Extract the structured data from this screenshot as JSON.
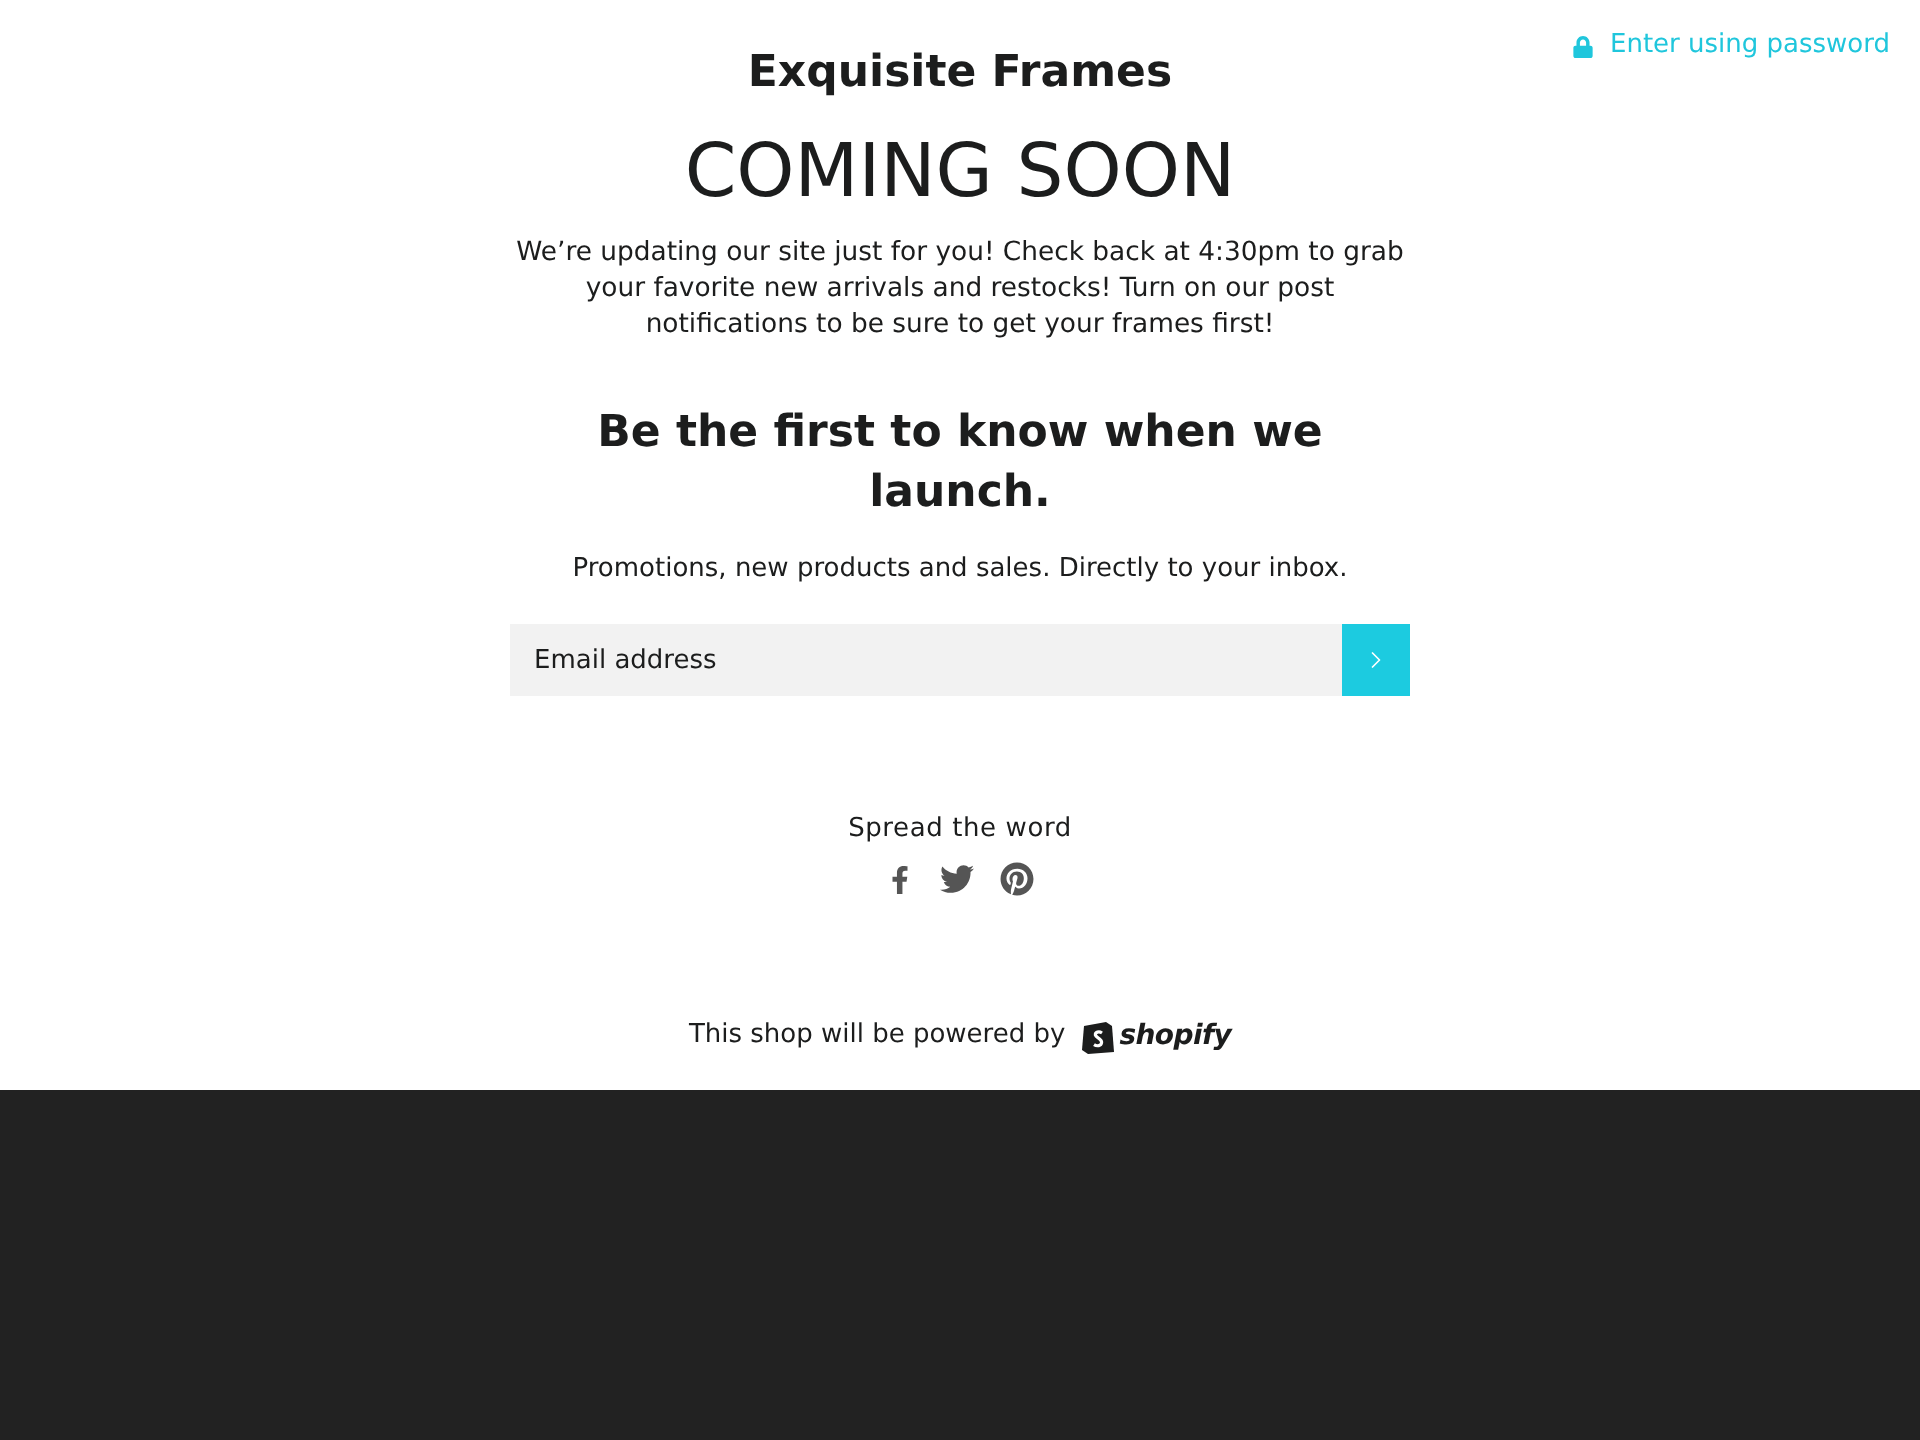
{
  "header": {
    "password_link": "Enter using password"
  },
  "store_name": "Exquisite Frames",
  "headline": "COMING SOON",
  "message": "We’re updating our site just for you! Check back at 4:30pm to grab your favorite new arrivals and restocks! Turn on our post notifications to be sure to get your frames first!",
  "signup": {
    "heading": "Be the first to know when we launch.",
    "subheading": "Promotions, new products and sales. Directly to your inbox.",
    "email_field": {
      "placeholder": "Email address"
    }
  },
  "share": {
    "label": "Spread the word",
    "networks": [
      {
        "kind": "facebook"
      },
      {
        "kind": "twitter"
      },
      {
        "kind": "pinterest"
      }
    ]
  },
  "footer": {
    "powered_by": "This shop will be powered by",
    "brand": "shopify"
  }
}
